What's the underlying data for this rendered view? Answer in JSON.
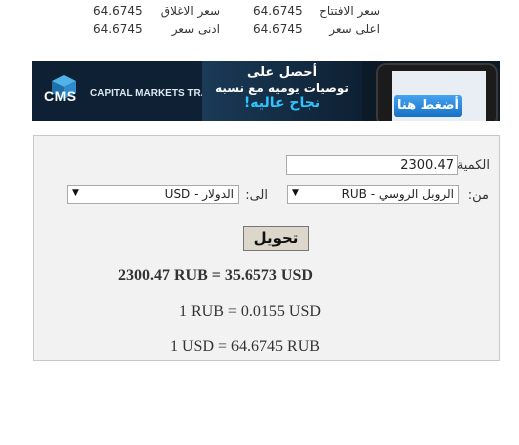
{
  "stats": {
    "open_label": "سعر الافتتاح",
    "open_value": "64.6745",
    "close_label": "سعر الاغلاق",
    "close_value": "64.6745",
    "high_label": "اعلى سعر",
    "high_value": "64.6745",
    "low_label": "ادنى سعر",
    "low_value": "64.6745"
  },
  "banner": {
    "logo_text": "CMS",
    "brand_text": "CAPITAL MARKETS TRADER",
    "line1": "أحصل على",
    "line2": "توصيات يوميه مع نسبه",
    "line3": "نجاح عاليه!",
    "cta": "أضغط هنا",
    "colors": {
      "cta": "#2a8ee0",
      "highlight": "#2ec4ff"
    }
  },
  "converter": {
    "amount_label": "الكمية",
    "amount_value": "2300.47",
    "from_label": "من:",
    "from_value": "RUB - الروبل الروسي",
    "to_label": "الى:",
    "to_value": "USD - الدولار",
    "convert_label": "تحويل",
    "result_main": "2300.47 RUB = 35.6573 USD",
    "rate_forward": "1 RUB = 0.0155 USD",
    "rate_reverse": "1 USD = 64.6745 RUB"
  }
}
